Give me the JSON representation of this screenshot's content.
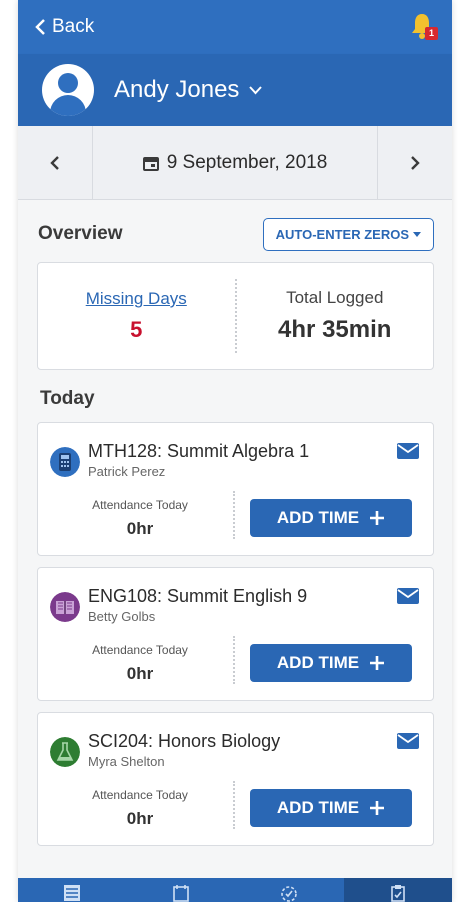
{
  "header": {
    "back_label": "Back",
    "notification_count": "1"
  },
  "user": {
    "name": "Andy Jones"
  },
  "date": {
    "label": "9 September, 2018"
  },
  "overview": {
    "title": "Overview",
    "auto_enter_label": "AUTO-ENTER ZEROS",
    "missing_days_label": "Missing Days",
    "missing_days_value": "5",
    "total_logged_label": "Total Logged",
    "total_logged_value": "4hr 35min"
  },
  "today": {
    "title": "Today",
    "courses": [
      {
        "title": "MTH128: Summit Algebra 1",
        "teacher": "Patrick Perez",
        "attendance_label": "Attendance Today",
        "attendance_value": "0hr",
        "button_label": "ADD TIME",
        "icon": "calculator-icon",
        "color": "#2f6fbf"
      },
      {
        "title": "ENG108: Summit English 9",
        "teacher": "Betty Golbs",
        "attendance_label": "Attendance Today",
        "attendance_value": "0hr",
        "button_label": "ADD TIME",
        "icon": "book-icon",
        "color": "#7b3a8c"
      },
      {
        "title": "SCI204: Honors Biology",
        "teacher": "Myra Shelton",
        "attendance_label": "Attendance Today",
        "attendance_value": "0hr",
        "button_label": "ADD TIME",
        "icon": "flask-icon",
        "color": "#2e7d32"
      }
    ]
  },
  "tabs": [
    "list-icon",
    "calendar-icon",
    "clock-check-icon",
    "clipboard-check-icon"
  ],
  "colors": {
    "primary": "#2a67b4",
    "alert": "#c8102e"
  }
}
